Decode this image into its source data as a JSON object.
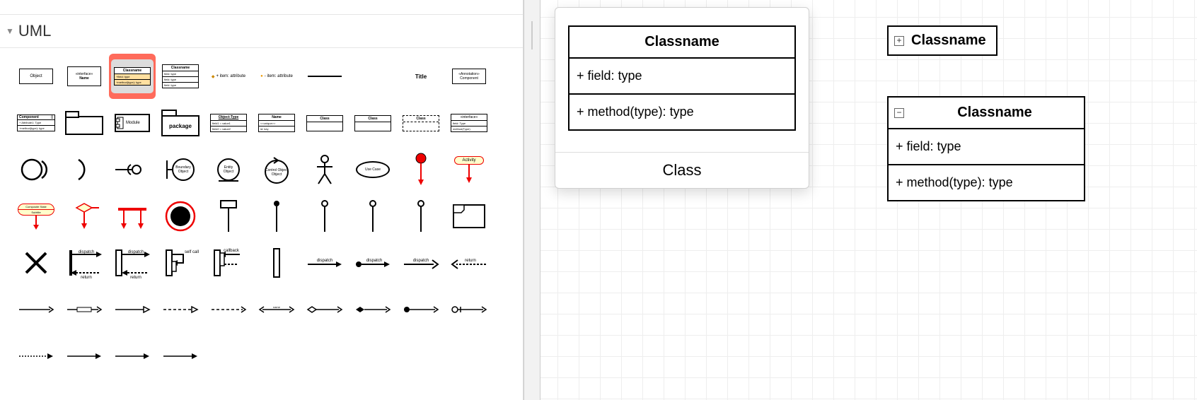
{
  "sidebar": {
    "section_title": "UML",
    "stencils": {
      "object": "Object",
      "interface_tag": "«interface»",
      "interface_name": "Name",
      "classname_s": "Classname",
      "class_field": "+field: type",
      "class_method": "+method(type): type",
      "item_attr_plus": "+ item: attribute",
      "item_attr_dash": "- item: attribute",
      "title": "Title",
      "annotation": "«Annotation»",
      "component_lbl": "Component",
      "component_attr": "+ Attribute1: Type",
      "module": "Module",
      "package": "package",
      "object_type": "Object:Type",
      "field1_value": "field1 = value1",
      "class_h": "Class",
      "interface_cls": "«interface»",
      "boundary": "Boundary Object",
      "entity": "Entity Object",
      "control": "Control Object",
      "use_case": "Use Case",
      "activity": "Activity",
      "composite_state": "Composite State",
      "subtitle": "Subtitle",
      "self_call": "self call",
      "callback": "callback",
      "dispatch": "dispatch",
      "return": "return",
      "name": "name"
    }
  },
  "popover": {
    "label": "Class",
    "preview": {
      "head": "Classname",
      "field": "+ field: type",
      "method": "+ method(type): type"
    }
  },
  "canvas": {
    "collapsed": {
      "name": "Classname"
    },
    "expanded": {
      "head": "Classname",
      "field": "+ field: type",
      "method": "+ method(type): type"
    },
    "expander_plus": "+",
    "expander_minus": "−"
  }
}
